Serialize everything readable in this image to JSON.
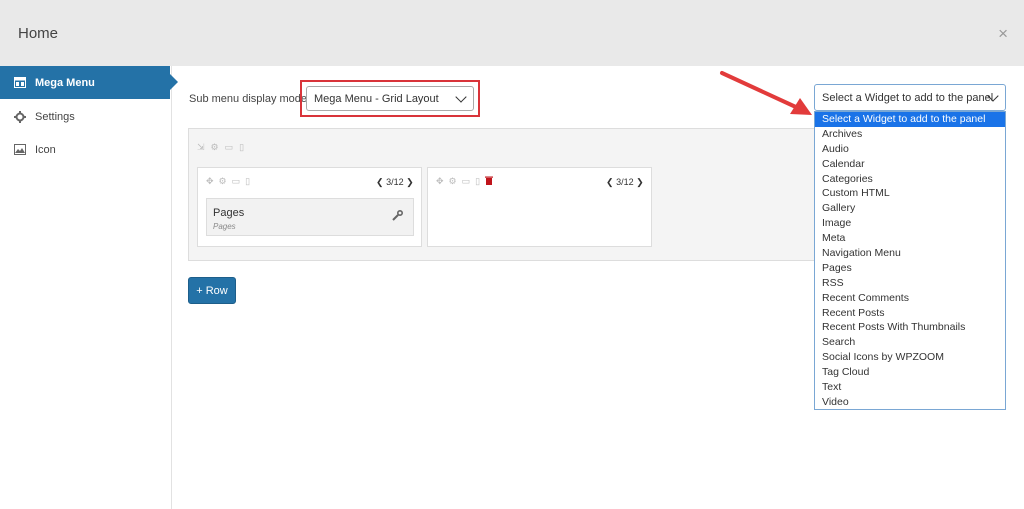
{
  "header": {
    "title": "Home",
    "close_symbol": "×"
  },
  "sidebar": {
    "items": [
      {
        "label": "Mega Menu",
        "icon": "mega-menu-icon",
        "active": true
      },
      {
        "label": "Settings",
        "icon": "gear-icon",
        "active": false
      },
      {
        "label": "Icon",
        "icon": "image-icon",
        "active": false
      }
    ]
  },
  "main": {
    "submenu_label": "Sub menu display mode",
    "mode_value": "Mega Menu - Grid Layout",
    "columns": [
      {
        "width_label": "3/12"
      },
      {
        "width_label": "3/12"
      }
    ],
    "widget": {
      "title": "Pages",
      "subtitle": "Pages"
    },
    "row_button": "+ Row"
  },
  "widget_select": {
    "value": "Select a Widget to add to the panel",
    "options": [
      "Select a Widget to add to the panel",
      "Archives",
      "Audio",
      "Calendar",
      "Categories",
      "Custom HTML",
      "Gallery",
      "Image",
      "Meta",
      "Navigation Menu",
      "Pages",
      "RSS",
      "Recent Comments",
      "Recent Posts",
      "Recent Posts With Thumbnails",
      "Search",
      "Social Icons by WPZOOM",
      "Tag Cloud",
      "Text",
      "Video"
    ]
  },
  "colors": {
    "accent": "#2472a7",
    "highlight": "#1a73e8",
    "annotation_red": "#d9343a"
  }
}
